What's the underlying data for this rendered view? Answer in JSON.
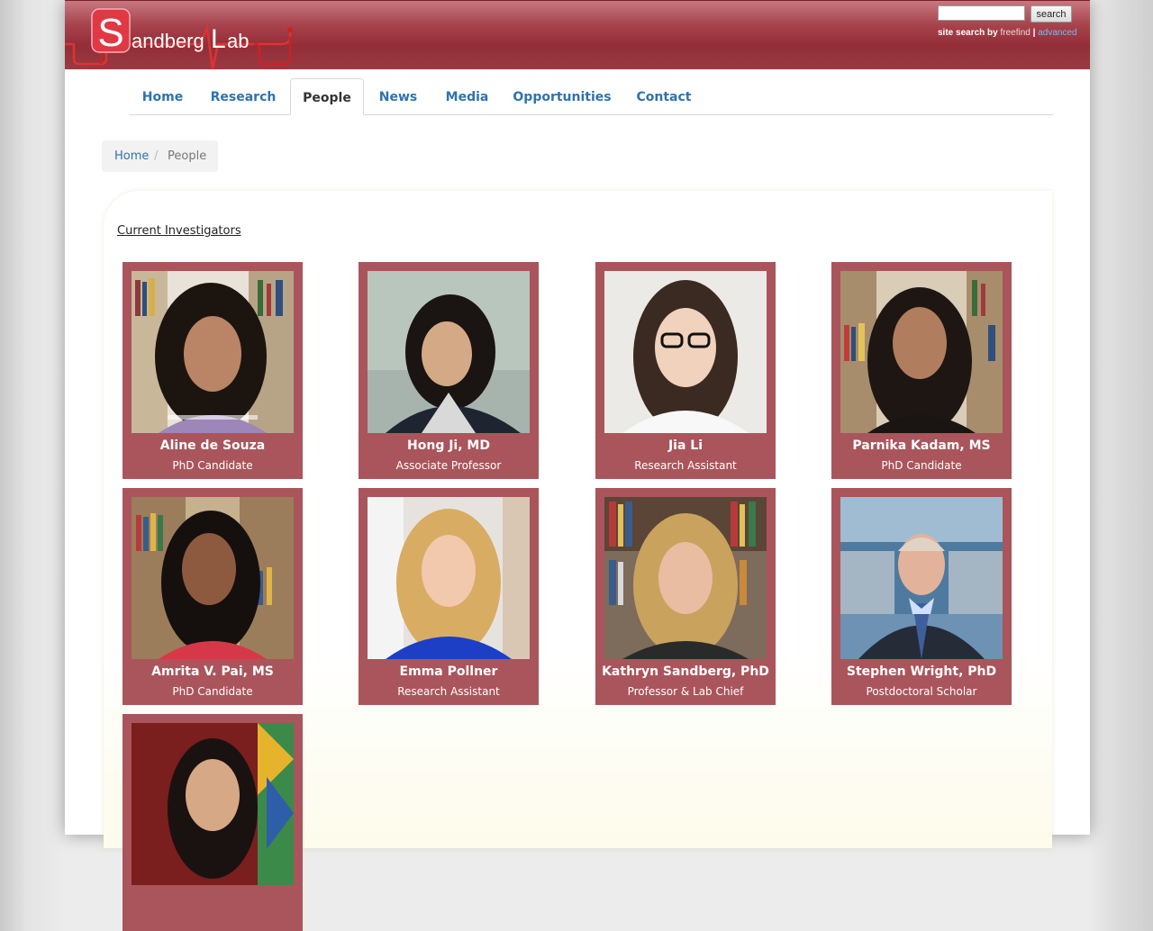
{
  "header": {
    "logo_text_s": "S",
    "logo_text_1": "andberg",
    "logo_text_l": "L",
    "logo_text_2": "ab",
    "search_button": "search",
    "site_search_label": "site search by",
    "freefind_link": "freefind",
    "separator": "|",
    "advanced_link": "advanced"
  },
  "nav": {
    "tabs": [
      {
        "label": "Home"
      },
      {
        "label": "Research"
      },
      {
        "label": "People"
      },
      {
        "label": "News"
      },
      {
        "label": "Media"
      },
      {
        "label": "Opportunities"
      },
      {
        "label": "Contact"
      }
    ],
    "active": "People"
  },
  "breadcrumb": {
    "home": "Home",
    "separator": "/",
    "current": "People"
  },
  "section_title": "Current Investigators",
  "people": [
    {
      "name": "Aline de Souza",
      "role": "PhD Candidate"
    },
    {
      "name": "Hong Ji, MD",
      "role": "Associate Professor"
    },
    {
      "name": "Jia Li",
      "role": "Research Assistant"
    },
    {
      "name": "Parnika Kadam, MS",
      "role": "PhD Candidate"
    },
    {
      "name": "Amrita V. Pai, MS",
      "role": "PhD Candidate"
    },
    {
      "name": "Emma Pollner",
      "role": "Research Assistant"
    },
    {
      "name": "Kathryn Sandberg, PhD",
      "role": "Professor & Lab Chief"
    },
    {
      "name": "Stephen Wright, PhD",
      "role": "Postdoctoral Scholar"
    },
    {
      "name": "",
      "role": ""
    }
  ],
  "colors": {
    "header": "#9a3a43",
    "card": "#a9555b",
    "link": "#2f73ad"
  }
}
